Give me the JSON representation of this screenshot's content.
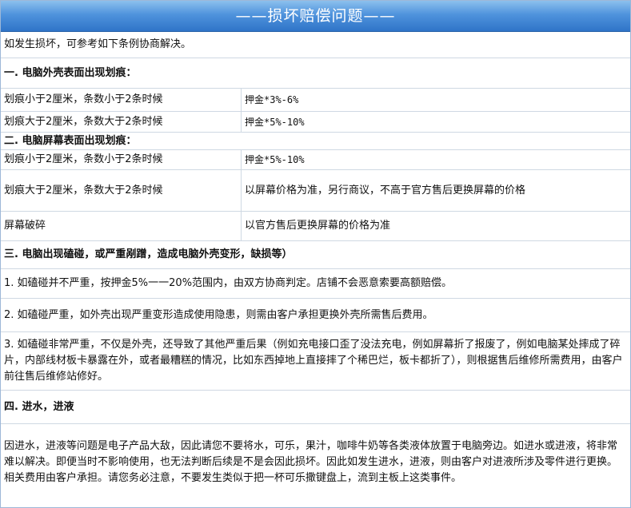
{
  "header": {
    "title": "——损坏赔偿问题——"
  },
  "intro": "如发生损坏，可参考如下条例协商解决。",
  "section1": {
    "heading": "一. 电脑外壳表面出现划痕：",
    "rows": [
      {
        "condition": "划痕小于2厘米，条数小于2条时候",
        "compensation": "押金*3%-6%"
      },
      {
        "condition": "划痕大于2厘米，条数大于2条时候",
        "compensation": "押金*5%-10%"
      }
    ]
  },
  "section2": {
    "heading": "二. 电脑屏幕表面出现划痕：",
    "rows": [
      {
        "condition": "划痕小于2厘米，条数小于2条时候",
        "compensation": "押金*5%-10%"
      },
      {
        "condition": "划痕大于2厘米，条数大于2条时候",
        "compensation": "以屏幕价格为准，另行商议，不高于官方售后更换屏幕的价格"
      },
      {
        "condition": "屏幕破碎",
        "compensation": "以官方售后更换屏幕的价格为准"
      }
    ]
  },
  "section3": {
    "heading": "三. 电脑出现磕碰，或严重剐蹭，造成电脑外壳变形，缺损等）",
    "items": [
      "1. 如磕碰并不严重，按押金5%一一20%范围内，由双方协商判定。店铺不会恶意索要高额赔偿。",
      "2. 如磕碰严重，如外壳出现严重变形造成使用隐患，则需由客户承担更换外壳所需售后费用。",
      "3. 如磕碰非常严重，不仅是外壳，还导致了其他严重后果（例如充电接口歪了没法充电，例如屏幕折了报废了，例如电脑某处摔成了碎片，内部线材板卡暴露在外，或者最糟糕的情况，比如东西掉地上直接摔了个稀巴烂，板卡都折了），则根据售后维修所需费用，由客户前往售后维修站修好。"
    ]
  },
  "section4": {
    "heading": "四. 进水，进液",
    "body": "因进水，进液等问题是电子产品大敌，因此请您不要将水，可乐，果汁，咖啡牛奶等各类液体放置于电脑旁边。如进水或进液，将非常难以解决。即便当时不影响使用，也无法判断后续是不是会因此损坏。因此如发生进水，进液，则由客户对进液所涉及零件进行更换。相关费用由客户承担。请您务必注意，不要发生类似于把一杯可乐撒键盘上，流到主板上这类事件。"
  }
}
